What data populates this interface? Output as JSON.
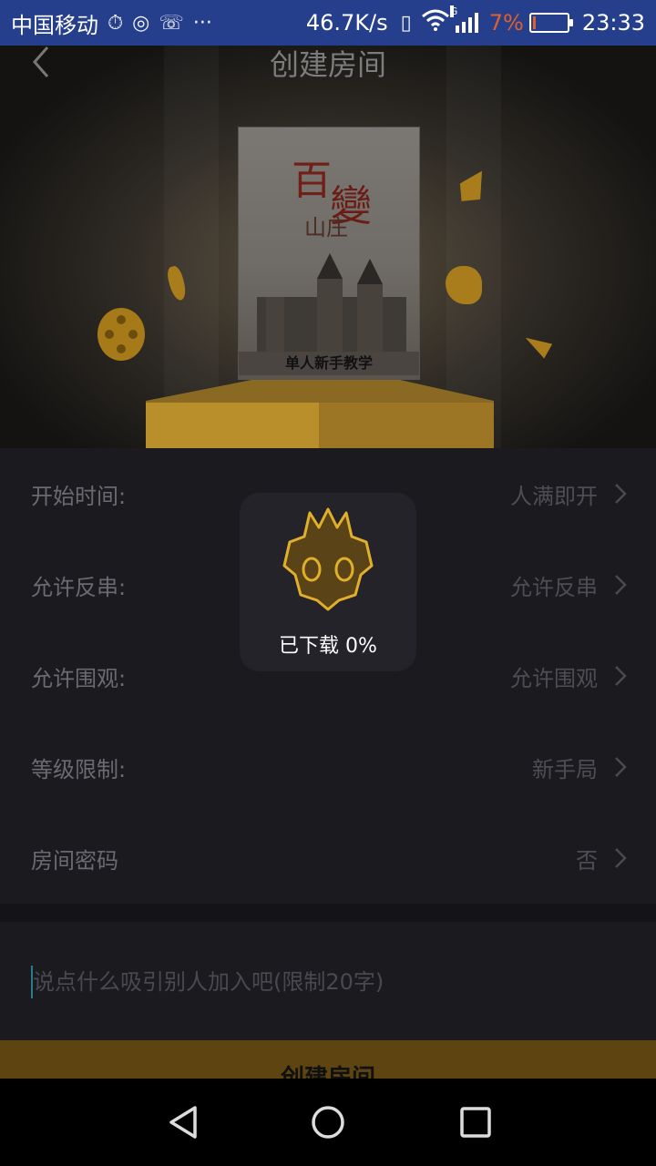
{
  "status_bar": {
    "carrier": "中国移动",
    "network_speed": "46.7K/s",
    "network_type": "G",
    "battery_percent": "7%",
    "battery_level": 0.07,
    "time": "23:33",
    "icons": [
      "alarm-icon",
      "location-icon",
      "phone-icon",
      "more-icon",
      "vibrate-icon",
      "wifi-icon",
      "signal-icon",
      "battery-icon"
    ]
  },
  "header": {
    "title": "创建房间",
    "back_icon": "chevron-left-icon"
  },
  "hero": {
    "cover_title_chars": [
      "百",
      "變",
      "山庄"
    ],
    "cover_caption": "单人新手教学"
  },
  "settings": [
    {
      "label": "开始时间:",
      "value": "人满即开"
    },
    {
      "label": "允许反串:",
      "value": "允许反串"
    },
    {
      "label": "允许围观:",
      "value": "允许围观"
    },
    {
      "label": "等级限制:",
      "value": "新手局"
    },
    {
      "label": "房间密码",
      "value": "否"
    }
  ],
  "message": {
    "placeholder": "说点什么吸引别人加入吧(限制20字)",
    "value": ""
  },
  "create_button": {
    "label": "创建房间"
  },
  "download_toast": {
    "text": "已下载 0%",
    "logo_icon": "mask-logo-icon"
  },
  "colors": {
    "status_bar": "#263f8c",
    "panel_bg": "#1b1a1f",
    "accent": "#e0b02a",
    "battery_low": "#e0602a"
  },
  "nav_bar": {
    "icons": [
      "back-triangle-icon",
      "home-circle-icon",
      "recents-square-icon"
    ]
  }
}
